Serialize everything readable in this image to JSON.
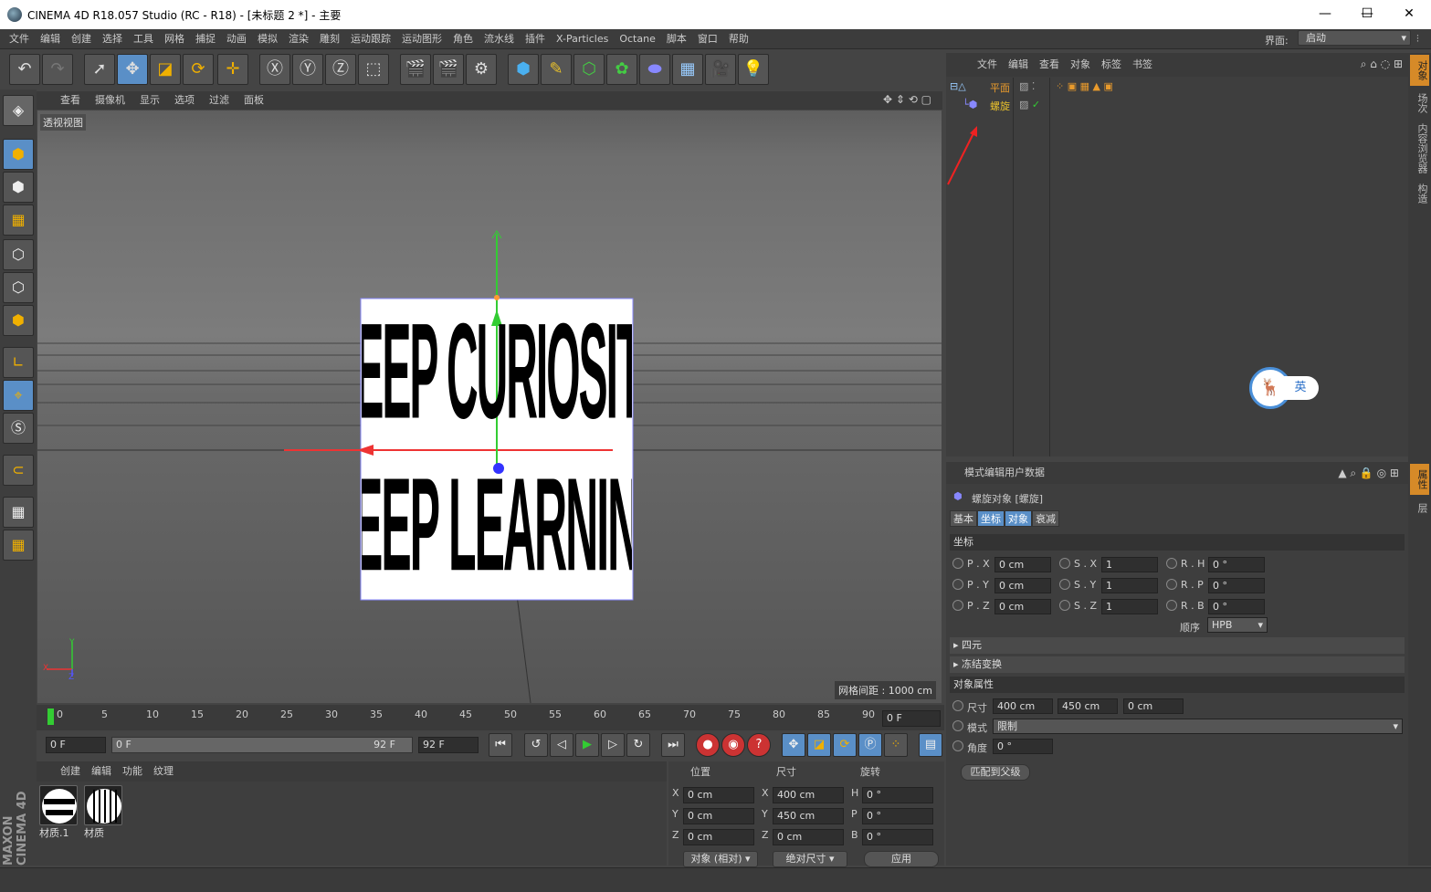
{
  "window": {
    "title": "CINEMA 4D R18.057 Studio (RC - R18) - [未标题 2 *] - 主要",
    "minimize": "—",
    "maximize": "☐",
    "close": "✕"
  },
  "menubar": {
    "items": [
      "文件",
      "编辑",
      "创建",
      "选择",
      "工具",
      "网格",
      "捕捉",
      "动画",
      "模拟",
      "渲染",
      "雕刻",
      "运动跟踪",
      "运动图形",
      "角色",
      "流水线",
      "插件",
      "X-Particles",
      "Octane",
      "脚本",
      "窗口",
      "帮助"
    ],
    "interface_label": "界面:",
    "interface_value": "启动"
  },
  "viewport": {
    "menu": [
      "查看",
      "摄像机",
      "显示",
      "选项",
      "过滤",
      "面板"
    ],
    "view_name": "透视视图",
    "grid_spacing": "网格间距 : 1000 cm",
    "text_line1": "KEEP CURIOSITY",
    "text_line2": "KEEP LEARNING",
    "axis_x": "X",
    "axis_y": "Y",
    "axis_z": "Z"
  },
  "timeline": {
    "ticks": [
      "0",
      "5",
      "10",
      "15",
      "20",
      "25",
      "30",
      "35",
      "40",
      "45",
      "50",
      "55",
      "60",
      "65",
      "70",
      "75",
      "80",
      "85",
      "90"
    ],
    "current_frame": "0 F",
    "start": "0 F",
    "range_start": "0 F",
    "range_end": "92 F",
    "end": "92 F"
  },
  "material_manager": {
    "menu": [
      "创建",
      "编辑",
      "功能",
      "纹理"
    ],
    "materials": [
      "材质.1",
      "材质"
    ]
  },
  "coordinates": {
    "headers": [
      "位置",
      "尺寸",
      "旋转"
    ],
    "rows": [
      {
        "axis": "X",
        "pos": "0 cm",
        "size_axis": "X",
        "size": "400 cm",
        "rot_axis": "H",
        "rot": "0 °"
      },
      {
        "axis": "Y",
        "pos": "0 cm",
        "size_axis": "Y",
        "size": "450 cm",
        "rot_axis": "P",
        "rot": "0 °"
      },
      {
        "axis": "Z",
        "pos": "0 cm",
        "size_axis": "Z",
        "size": "0 cm",
        "rot_axis": "B",
        "rot": "0 °"
      }
    ],
    "mode1": "对象 (相对)",
    "mode2": "绝对尺寸",
    "apply": "应用"
  },
  "object_manager": {
    "menu": [
      "文件",
      "编辑",
      "查看",
      "对象",
      "标签",
      "书签"
    ],
    "objects": [
      {
        "name": "平面",
        "color": "#e89a2c"
      },
      {
        "name": "螺旋",
        "color": "#e8c02c"
      }
    ]
  },
  "attribute_manager": {
    "menu": [
      "模式",
      "编辑",
      "用户数据"
    ],
    "object_title": "螺旋对象 [螺旋]",
    "tabs": [
      "基本",
      "坐标",
      "对象",
      "衰减"
    ],
    "coord_section": "坐标",
    "p": [
      {
        "l": "P . X",
        "v": "0 cm"
      },
      {
        "l": "P . Y",
        "v": "0 cm"
      },
      {
        "l": "P . Z",
        "v": "0 cm"
      }
    ],
    "s": [
      {
        "l": "S . X",
        "v": "1"
      },
      {
        "l": "S . Y",
        "v": "1"
      },
      {
        "l": "S . Z",
        "v": "1"
      }
    ],
    "r": [
      {
        "l": "R . H",
        "v": "0 °"
      },
      {
        "l": "R . P",
        "v": "0 °"
      },
      {
        "l": "R . B",
        "v": "0 °"
      }
    ],
    "order_label": "顺序",
    "order_value": "HPB",
    "quaternion": "四元",
    "freeze": "冻结变换",
    "obj_props": "对象属性",
    "size_label": "尺寸",
    "size": [
      "400 cm",
      "450 cm",
      "0 cm"
    ],
    "mode_label": "模式",
    "mode_value": "限制",
    "angle_label": "角度",
    "angle_value": "0 °",
    "fit_parent": "匹配到父级"
  },
  "right_tabs": [
    "对象",
    "场次",
    "内容浏览器",
    "构造"
  ],
  "right_tabs2": [
    "属性",
    "层"
  ],
  "ime": {
    "label": "英"
  },
  "brand": "MAXON CINEMA 4D"
}
